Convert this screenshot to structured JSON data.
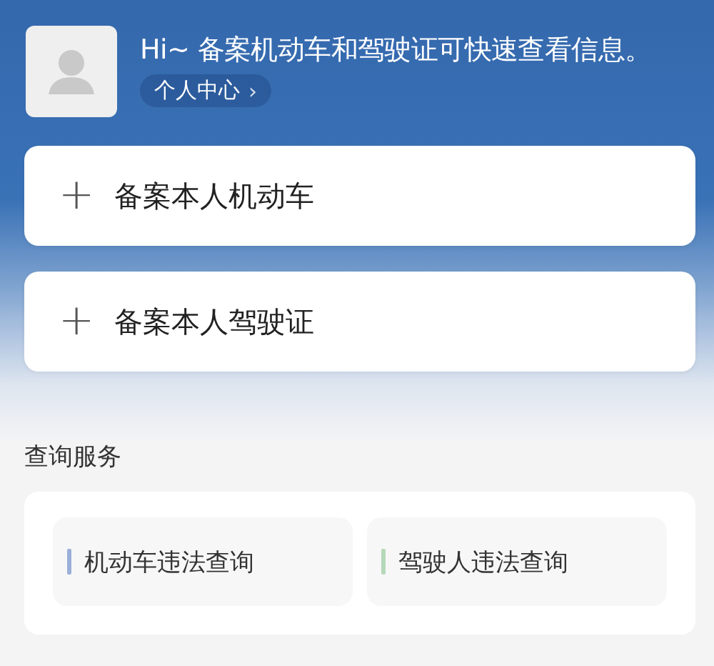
{
  "profile": {
    "greeting": "Hi~ 备案机动车和驾驶证可快速查看信息。",
    "link": "个人中心",
    "link_arrow": "›"
  },
  "actions": [
    {
      "icon": "+",
      "label": "备案本人机动车"
    },
    {
      "icon": "+",
      "label": "备案本人驾驶证"
    }
  ],
  "section": {
    "title": "查询服务"
  },
  "services": [
    {
      "label": "机动车违法查询",
      "color": "#9aaed8"
    },
    {
      "label": "驾驶人违法查询",
      "color": "#b5d8b8"
    }
  ]
}
